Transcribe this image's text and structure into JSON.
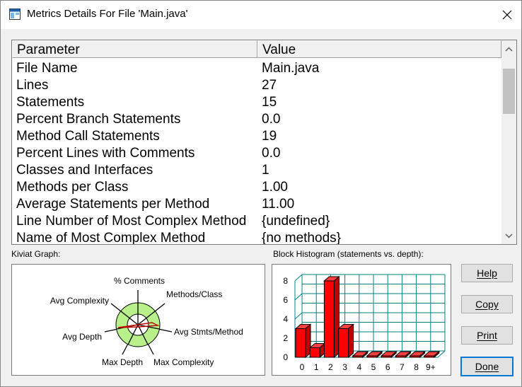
{
  "window": {
    "title": "Metrics Details For File 'Main.java'",
    "icon": "app-window-icon",
    "close_icon": "close-icon"
  },
  "table": {
    "headers": [
      "Parameter",
      "Value"
    ],
    "rows": [
      [
        "File Name",
        "Main.java"
      ],
      [
        "Lines",
        "27"
      ],
      [
        "Statements",
        "15"
      ],
      [
        "Percent Branch Statements",
        "0.0"
      ],
      [
        "Method Call Statements",
        "19"
      ],
      [
        "Percent Lines with Comments",
        "0.0"
      ],
      [
        "Classes and Interfaces",
        "1"
      ],
      [
        "Methods per Class",
        "1.00"
      ],
      [
        "Average Statements per Method",
        "11.00"
      ],
      [
        "Line Number of Most Complex Method",
        "{undefined}"
      ],
      [
        "Name of Most Complex Method",
        "{no methods}"
      ]
    ]
  },
  "kiviat": {
    "label": "Kiviat Graph:",
    "axes": [
      "% Comments",
      "Methods/Class",
      "Avg Stmts/Method",
      "Max Complexity",
      "Max Depth",
      "Avg Depth",
      "Avg Complexity"
    ]
  },
  "histogram": {
    "label": "Block Histogram (statements vs. depth):",
    "y_ticks": [
      "0",
      "2",
      "4",
      "6",
      "8"
    ],
    "categories": [
      "0",
      "1",
      "2",
      "3",
      "4",
      "5",
      "6",
      "7",
      "8",
      "9+"
    ],
    "values": [
      3,
      1,
      8,
      3,
      0,
      0,
      0,
      0,
      0,
      0
    ],
    "ylim": [
      0,
      8
    ],
    "bar_color": "#ff0000"
  },
  "buttons": {
    "help": "Help",
    "copy": "Copy",
    "print": "Print",
    "done": "Done"
  },
  "colors": {
    "accent": "#0078d7",
    "grid": "#008080",
    "kiviat_fill": "#b8f08a"
  }
}
